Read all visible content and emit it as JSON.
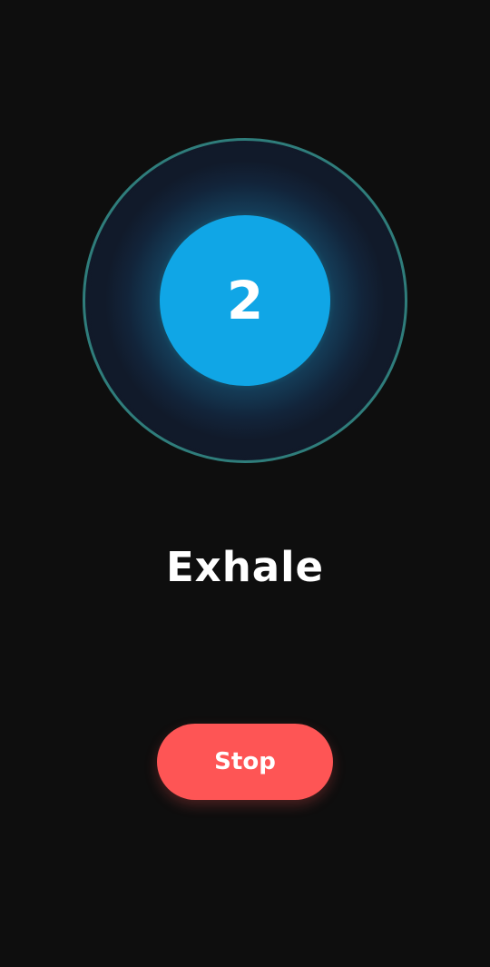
{
  "breathing": {
    "count": "2",
    "phase": "Exhale"
  },
  "controls": {
    "stop_label": "Stop"
  },
  "colors": {
    "background": "#0e0e0e",
    "ring_border": "#2f7d7b",
    "inner_circle": "#10a6e6",
    "stop_button": "#fe5555",
    "text": "#ffffff"
  }
}
